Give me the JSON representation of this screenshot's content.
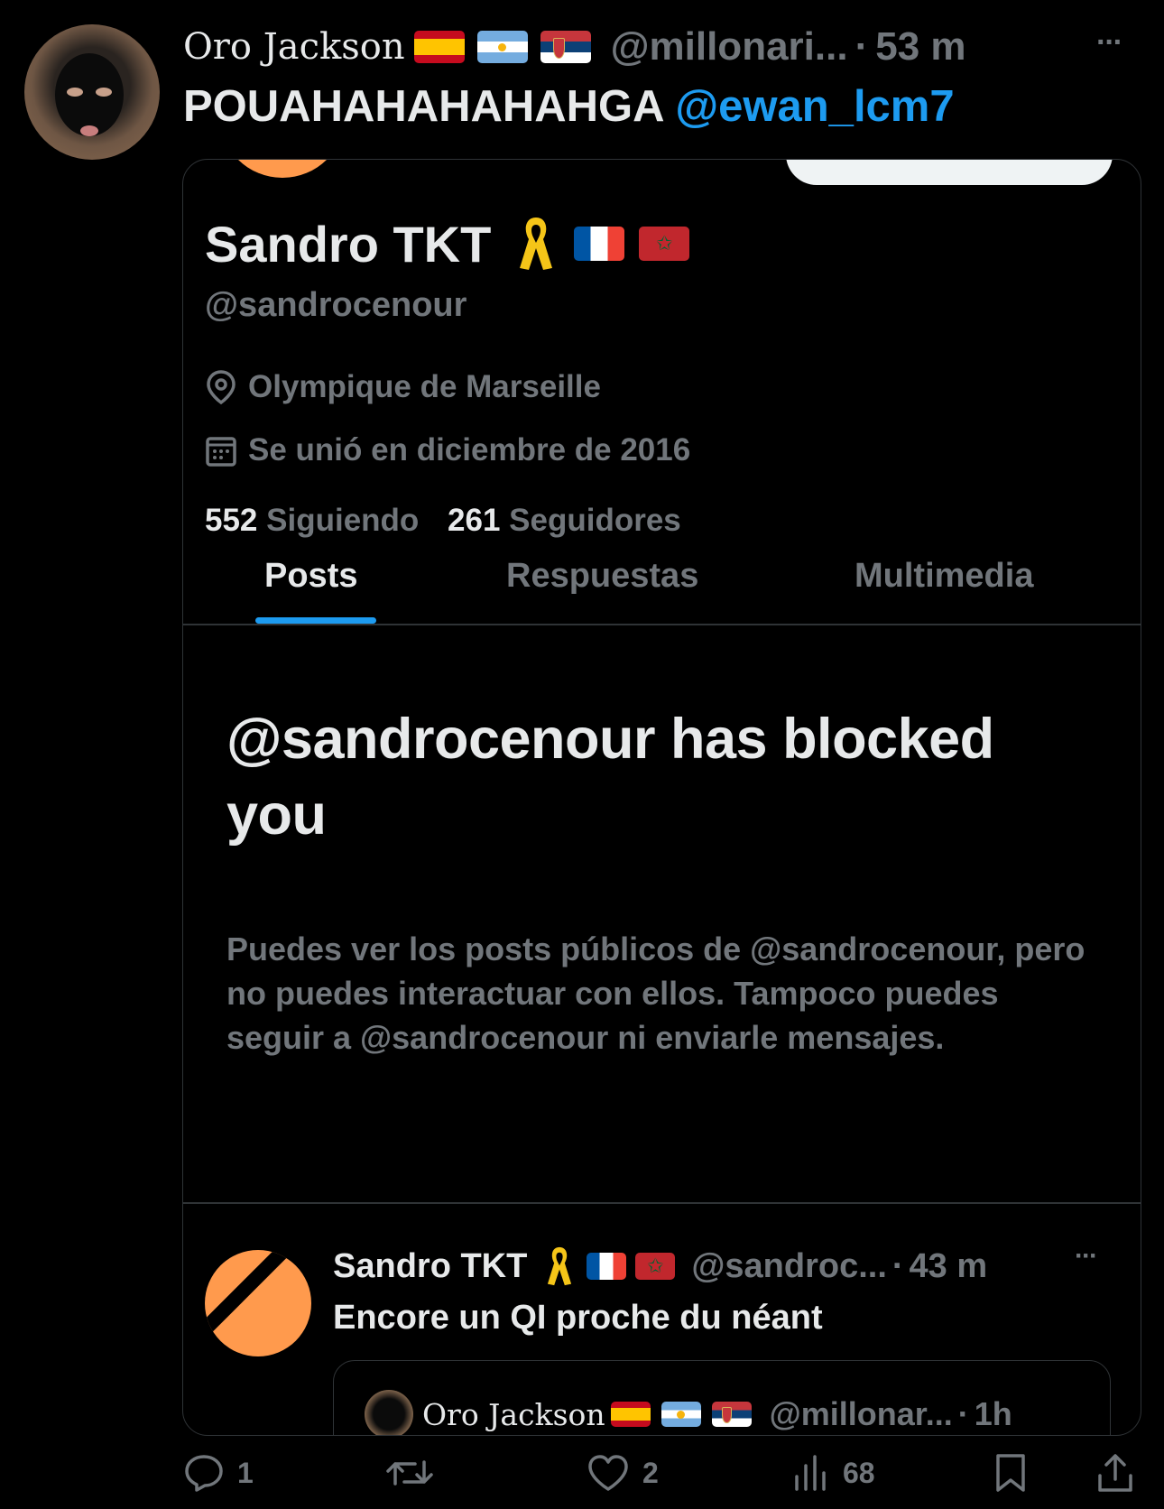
{
  "tweet": {
    "display_name": "Oro Jackson",
    "handle": "@millonari...",
    "time": "53 m",
    "more": "···",
    "text": "POUAHAHAHAHAHGA",
    "mention": "@ewan_lcm7"
  },
  "screenshot": {
    "profile": {
      "name": "Sandro TKT",
      "handle": "@sandrocenour",
      "location": "Olympique de Marseille",
      "joined": "Se unió en diciembre de 2016",
      "following_count": "552",
      "following_label": "Siguiendo",
      "followers_count": "261",
      "followers_label": "Seguidores"
    },
    "tabs": [
      "Posts",
      "Respuestas",
      "Multimedia"
    ],
    "blocked": {
      "title": "@sandrocenour has blocked you",
      "description": "Puedes ver los posts públicos de @sandrocenour, pero no puedes interactuar con ellos. Tampoco puedes seguir a @sandrocenour ni enviarle mensajes."
    },
    "post": {
      "name": "Sandro TKT",
      "handle": "@sandroc...",
      "time": "43 m",
      "more": "···",
      "text": "Encore un QI proche du néant",
      "quote": {
        "name": "Oro Jackson",
        "handle": "@millonar...",
        "time": "1h"
      }
    }
  },
  "actions": {
    "replies": "1",
    "likes": "2",
    "views": "68"
  },
  "colors": {
    "accent": "#1d9bf0",
    "background": "#000000",
    "orange_avatar": "#ff9a4d",
    "muted": "#71767b"
  }
}
